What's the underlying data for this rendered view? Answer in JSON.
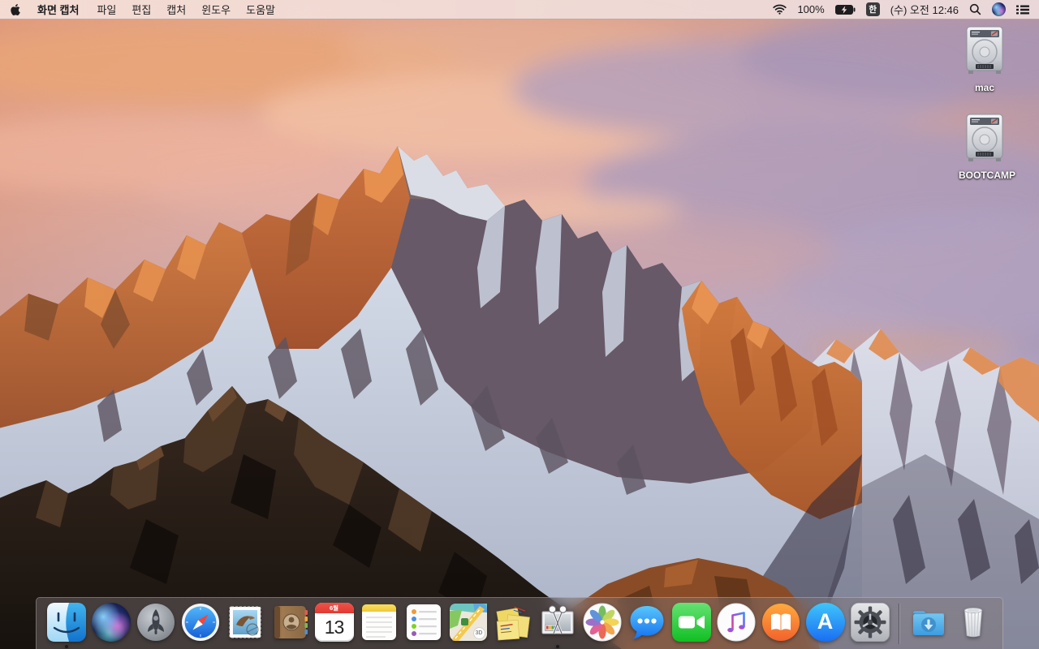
{
  "menu_bar": {
    "app_name": "화면 캡처",
    "menus": [
      {
        "label": "파일"
      },
      {
        "label": "편집"
      },
      {
        "label": "캡처"
      },
      {
        "label": "윈도우"
      },
      {
        "label": "도움말"
      }
    ],
    "status": {
      "battery_percent": "100%",
      "input_source_badge": "한",
      "clock": "(수) 오전 12:46"
    },
    "status_icons": [
      "wifi-icon",
      "battery-charging-icon",
      "input-source-badge",
      "spotlight-icon",
      "siri-icon",
      "notification-center-icon"
    ]
  },
  "desktop": {
    "volumes": [
      {
        "label": "mac",
        "type": "internal-hard-drive"
      },
      {
        "label": "BOOTCAMP",
        "type": "internal-hard-drive"
      }
    ]
  },
  "dock": {
    "apps": [
      "Finder",
      "Siri",
      "Launchpad",
      "Safari",
      "Mail",
      "Contacts",
      "Calendar",
      "Notes",
      "Reminders",
      "Maps",
      "Stickies",
      "Grab",
      "Photos",
      "Messages",
      "FaceTime",
      "iTunes",
      "iBooks",
      "App Store",
      "System Preferences"
    ],
    "others": [
      "Downloads",
      "Trash"
    ],
    "running_apps": [
      "Finder",
      "Grab"
    ],
    "calendar_badge": {
      "month": "6월",
      "day": "13"
    },
    "maps_badge": "3D",
    "app_store_letter": "A"
  },
  "colors": {
    "menu_bar_bg": "#f3ded6",
    "dock_bg": "rgba(126,116,119,0.44)",
    "sky_top_left": "#e0a089",
    "sky_right": "#b0a5c4",
    "sunlit_rock": "#cc7440",
    "shadow_rock": "#675967",
    "snow": "#d2d9e6",
    "foreground_rock": "#2a2018"
  }
}
